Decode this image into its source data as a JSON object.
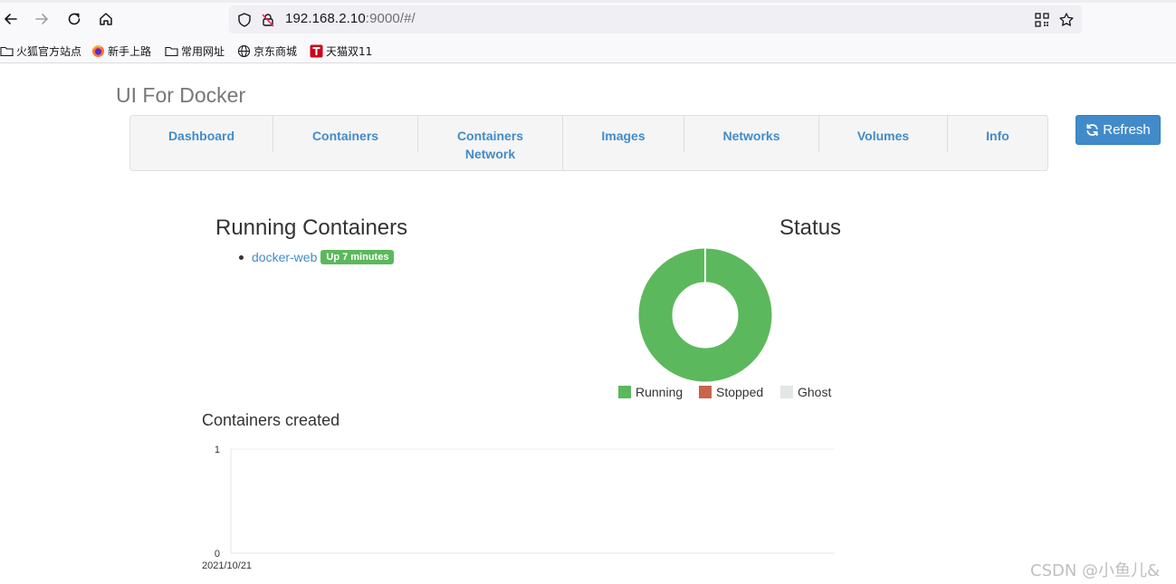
{
  "browser": {
    "url_host": "192.168.2.10",
    "url_rest": ":9000/#/",
    "bookmarks": [
      {
        "label": "火狐官方站点",
        "icon": "folder-icon"
      },
      {
        "label": "新手上路",
        "icon": "firefox-icon"
      },
      {
        "label": "常用网址",
        "icon": "folder-icon"
      },
      {
        "label": "京东商城",
        "icon": "globe-icon"
      },
      {
        "label": "天猫双11",
        "icon": "tmall-icon"
      }
    ]
  },
  "app": {
    "title": "UI For Docker",
    "refresh_label": "Refresh",
    "nav": [
      {
        "label": "Dashboard"
      },
      {
        "label": "Containers"
      },
      {
        "label": "Containers Network"
      },
      {
        "label": "Images"
      },
      {
        "label": "Networks"
      },
      {
        "label": "Volumes"
      },
      {
        "label": "Info"
      }
    ]
  },
  "running": {
    "title": "Running Containers",
    "items": [
      {
        "name": "docker-web",
        "status": "Up 7 minutes"
      }
    ]
  },
  "status": {
    "title": "Status"
  },
  "created": {
    "title": "Containers created"
  },
  "colors": {
    "accent": "#428bca",
    "running": "#5cb85c",
    "stopped": "#c9644d",
    "ghost": "#e2e6e4"
  },
  "watermark": "CSDN @小鱼儿&",
  "chart_data": [
    {
      "type": "pie",
      "title": "Status",
      "categories": [
        "Running",
        "Stopped",
        "Ghost"
      ],
      "values": [
        1,
        0,
        0
      ],
      "legend": "bottom"
    },
    {
      "type": "line",
      "title": "Containers created",
      "x": [
        "2021/10/21"
      ],
      "series": [
        {
          "values": [
            1
          ]
        }
      ],
      "ylim": [
        0,
        1
      ],
      "yticks": [
        "1",
        "0"
      ],
      "grid": true
    }
  ]
}
